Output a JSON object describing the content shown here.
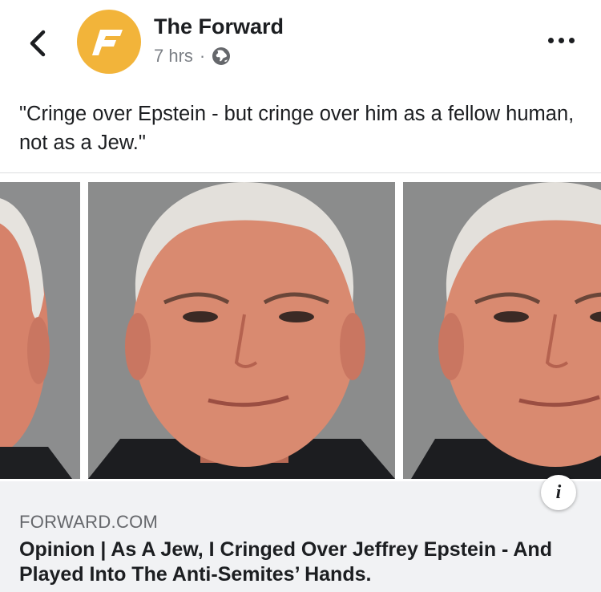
{
  "header": {
    "page_name": "The Forward",
    "time": "7 hrs",
    "separator": "·",
    "privacy_icon": "globe-icon",
    "back_icon": "chevron-left-icon",
    "more_icon": "more-horizontal-icon",
    "avatar_logo": "F",
    "avatar_color": "#f2b43a"
  },
  "post": {
    "text": "\"Cringe over Epstein - but cringe over him as a fellow human, not as a Jew.\""
  },
  "link_preview": {
    "domain": "FORWARD.COM",
    "headline": "Opinion | As A Jew, I Cringed Over Jeffrey Epstein - And Played Into The Anti-Semites’ Hands.",
    "info_icon": "info-icon",
    "info_glyph": "i"
  },
  "colors": {
    "text_primary": "#1c1e21",
    "text_secondary": "#65676b",
    "card_background": "#f1f2f4"
  }
}
